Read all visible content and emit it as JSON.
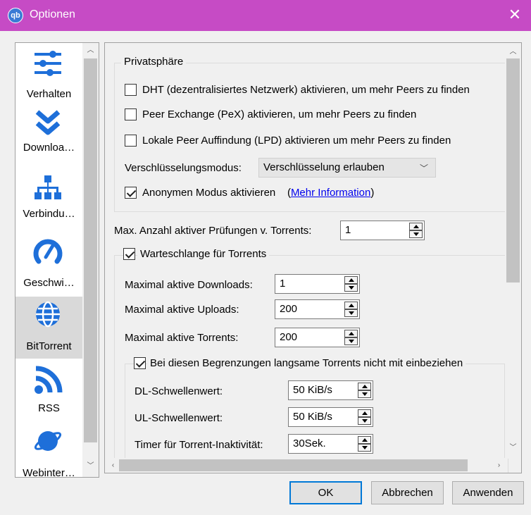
{
  "window": {
    "title": "Optionen",
    "app_icon": "qb",
    "close": "✕"
  },
  "sidebar": {
    "items": [
      {
        "label": "Verhalten",
        "icon": "sliders-icon"
      },
      {
        "label": "Downloa…",
        "icon": "downloads-icon"
      },
      {
        "label": "Verbindu…",
        "icon": "network-icon"
      },
      {
        "label": "Geschwi…",
        "icon": "speedometer-icon"
      },
      {
        "label": "BitTorrent",
        "icon": "globe-icon",
        "selected": true
      },
      {
        "label": "RSS",
        "icon": "rss-icon"
      },
      {
        "label": "Webinter…",
        "icon": "planet-icon"
      }
    ]
  },
  "privacy": {
    "title": "Privatsphäre",
    "dht_label": "DHT (dezentralisiertes Netzwerk) aktivieren, um mehr Peers zu finden",
    "dht_checked": false,
    "pex_label": "Peer Exchange (PeX) aktivieren, um mehr Peers zu finden",
    "pex_checked": false,
    "lpd_label": "Lokale Peer Auffindung (LPD) aktivieren um mehr Peers zu finden",
    "lpd_checked": false,
    "encryption_label": "Verschlüsselungsmodus:",
    "encryption_value": "Verschlüsselung erlauben",
    "anon_label": "Anonymen Modus aktivieren",
    "anon_checked": true,
    "more_info_open": "(",
    "more_info_link": "Mehr Information",
    "more_info_close": ")"
  },
  "max_checks": {
    "label": "Max. Anzahl aktiver Prüfungen v. Torrents:",
    "value": "1"
  },
  "queue": {
    "title": "Warteschlange für Torrents",
    "checked": true,
    "max_downloads_label": "Maximal aktive Downloads:",
    "max_downloads_value": "1",
    "max_uploads_label": "Maximal aktive Uploads:",
    "max_uploads_value": "200",
    "max_torrents_label": "Maximal aktive Torrents:",
    "max_torrents_value": "200",
    "slow": {
      "title": "Bei diesen Begrenzungen langsame Torrents nicht mit einbeziehen",
      "checked": true,
      "dl_label": "DL-Schwellenwert:",
      "dl_value": "50 KiB/s",
      "ul_label": "UL-Schwellenwert:",
      "ul_value": "50 KiB/s",
      "timer_label": "Timer für Torrent-Inaktivität:",
      "timer_value": "30Sek."
    }
  },
  "buttons": {
    "ok": "OK",
    "cancel": "Abbrechen",
    "apply": "Anwenden"
  }
}
